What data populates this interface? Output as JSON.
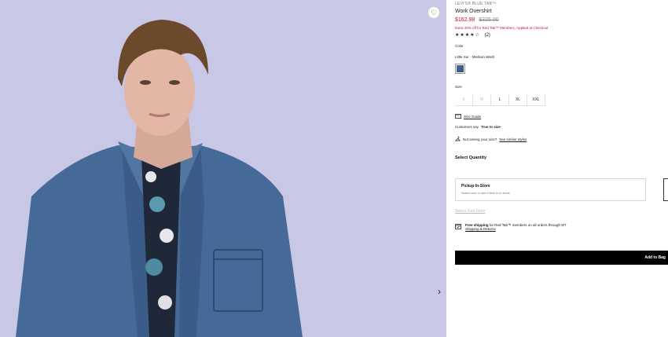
{
  "product": {
    "brand": "LEVI'S® BLUE TAB™",
    "title": "Work Overshirt",
    "sale_price": "$162.98",
    "original_price": "$325.00",
    "promo": "Extra 40% off for Red Tab™ Members, Applied at Checkout",
    "stars": "★★★★☆",
    "review_count": "(2)",
    "rating_value": 4.5
  },
  "color": {
    "label": "Color",
    "selected": "Little Sur - Medium Wash",
    "swatch_color": "#3f5f92"
  },
  "size": {
    "label": "Size",
    "options": [
      {
        "label": "S",
        "available": false
      },
      {
        "label": "M",
        "available": false
      },
      {
        "label": "L",
        "available": true
      },
      {
        "label": "XL",
        "available": true
      },
      {
        "label": "XXL",
        "available": true
      }
    ],
    "guide": "Size Guide",
    "fit_prefix": "Customers say",
    "fit_value": "True to size",
    "not_seeing": "Not seeing your size?",
    "similar": "See similar styles"
  },
  "quantity": {
    "label": "Select Quantity"
  },
  "pickup": {
    "title": "Pickup In-Store",
    "subtitle": "Select size to see if item is in stock"
  },
  "store_link": "Select Your Store",
  "shipping": {
    "bold": "Free shipping",
    "text": "for Red Tab™ members on all orders through 8/7",
    "link": "Shipping & Returns"
  },
  "cta": {
    "add_to_bag": "Add to Bag"
  },
  "icons": {
    "wishlist": "heart-icon",
    "next": "chevron-right-icon",
    "ruler": "ruler-icon",
    "hanger": "hanger-icon",
    "calendar": "calendar-icon"
  },
  "colors": {
    "sale": "#c41230",
    "hero_bg": "#c9c7e6",
    "cta_bg": "#000000"
  }
}
